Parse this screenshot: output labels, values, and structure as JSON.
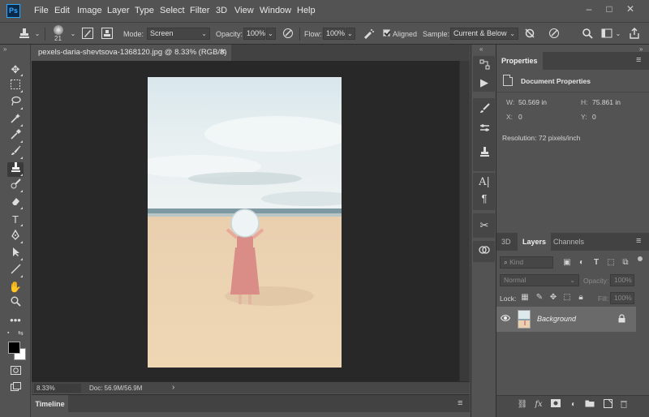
{
  "app": {
    "logo": "Ps"
  },
  "menu": [
    "File",
    "Edit",
    "Image",
    "Layer",
    "Type",
    "Select",
    "Filter",
    "3D",
    "View",
    "Window",
    "Help"
  ],
  "window_controls": {
    "minimize": "–",
    "maximize": "□",
    "close": "✕"
  },
  "options": {
    "brush_size": "21",
    "mode_label": "Mode:",
    "mode_value": "Screen",
    "opacity_label": "Opacity:",
    "opacity_value": "100%",
    "flow_label": "Flow:",
    "flow_value": "100%",
    "aligned_label": "Aligned",
    "aligned_checked": true,
    "sample_label": "Sample:",
    "sample_value": "Current & Below"
  },
  "document": {
    "tab_title": "pexels-daria-shevtsova-1368120.jpg @ 8.33% (RGB/8)",
    "close": "✕"
  },
  "status": {
    "zoom": "8.33%",
    "doc_info": "Doc: 56.9M/56.9M",
    "arrow": "›"
  },
  "timeline": {
    "tab": "Timeline"
  },
  "properties": {
    "tab": "Properties",
    "section": "Document Properties",
    "w_label": "W:",
    "w_value": "50.569 in",
    "h_label": "H:",
    "h_value": "75.861 in",
    "x_label": "X:",
    "x_value": "0",
    "y_label": "Y:",
    "y_value": "0",
    "resolution": "Resolution: 72 pixels/inch"
  },
  "layers_panel": {
    "tabs": [
      "3D",
      "Layers",
      "Channels"
    ],
    "active_tab": "Layers",
    "filter_placeholder": "Kind",
    "blend_mode": "Normal",
    "opacity_label": "Opacity:",
    "opacity_value": "100%",
    "lock_label": "Lock:",
    "fill_label": "Fill:",
    "fill_value": "100%",
    "layers": [
      {
        "name": "Background",
        "visible": true,
        "locked": true
      }
    ]
  },
  "colors": {
    "ui_bg": "#535353",
    "canvas_bg": "#282828",
    "accent": "#31a8ff"
  }
}
